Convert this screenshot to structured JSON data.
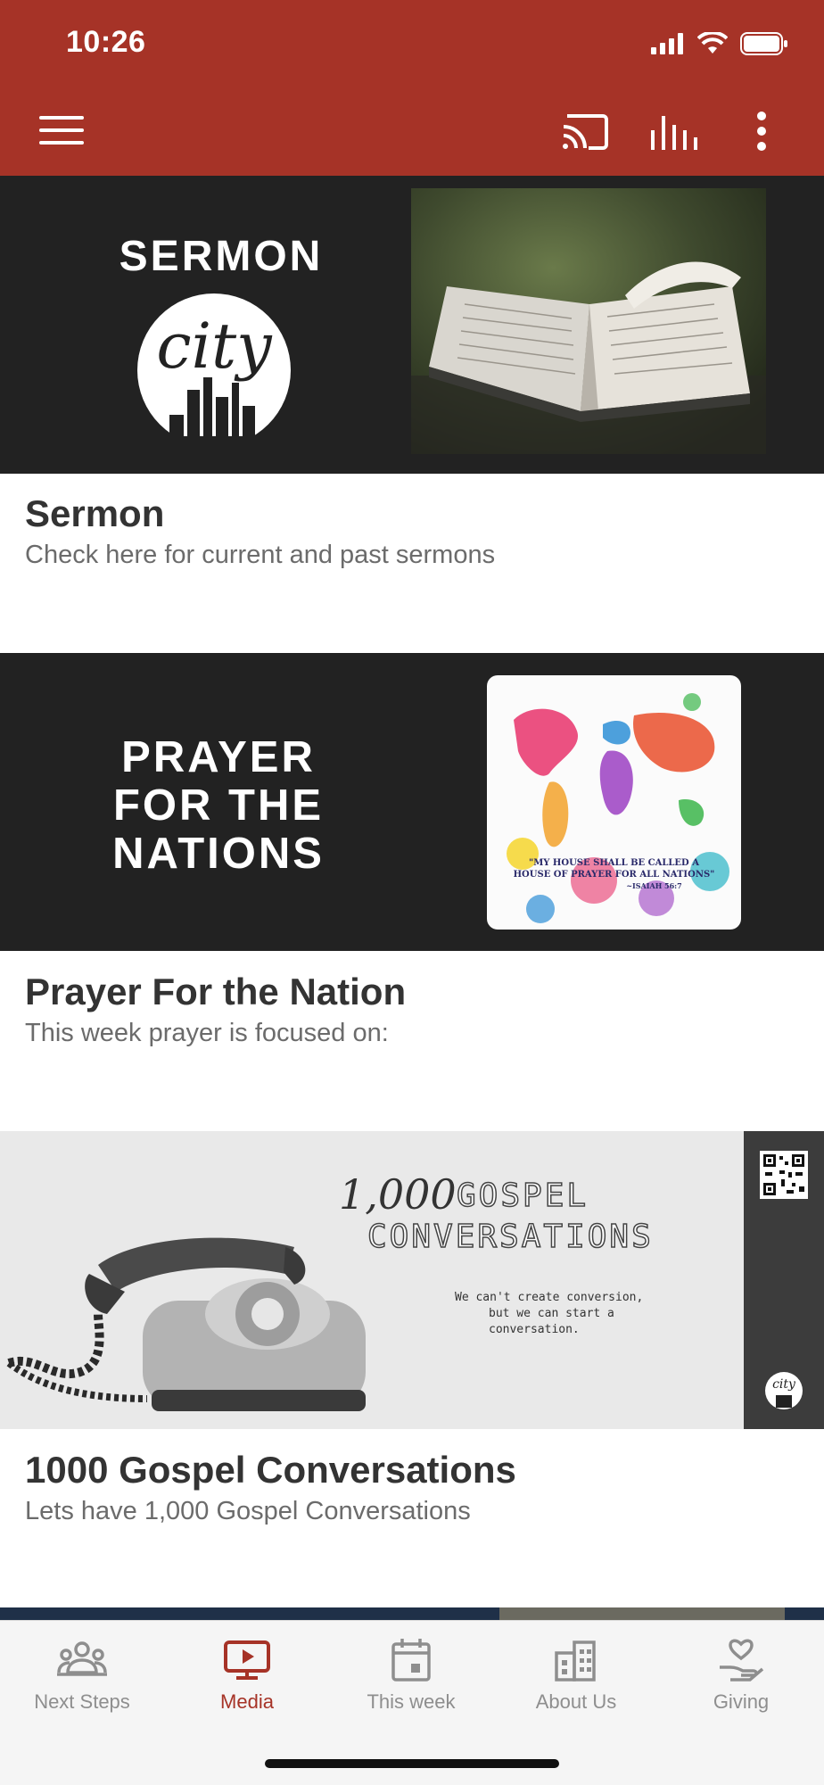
{
  "status_bar": {
    "time": "10:26"
  },
  "app_bar": {
    "menu_icon": "hamburger-icon",
    "actions": [
      "cast-icon",
      "equalizer-icon",
      "more-vertical-icon"
    ]
  },
  "cards": [
    {
      "banner_heading": "SERMON",
      "banner_logo_text": "city",
      "title": "Sermon",
      "description": "Check here for current and past sermons"
    },
    {
      "banner_heading_lines": [
        "PRAYER",
        "FOR THE",
        "NATIONS"
      ],
      "map_quote_line1": "\"MY HOUSE SHALL BE CALLED A",
      "map_quote_line2": "HOUSE OF PRAYER FOR ALL NATIONS\"",
      "map_quote_ref": "~ISAIAH 56:7",
      "title": "Prayer For the Nation",
      "description": "This week prayer is focused on:"
    },
    {
      "banner_count": "1,000",
      "banner_word1": "GOSPEL",
      "banner_word2": "CONVERSATIONS",
      "banner_tagline1": "We can't create conversion,",
      "banner_tagline2": "but we can start a conversation.",
      "banner_logo_text": "city",
      "title": "1000 Gospel Conversations",
      "description": "Lets have 1,000 Gospel Conversations"
    }
  ],
  "tabs": [
    {
      "label": "Next Steps",
      "icon": "people-group-icon",
      "active": false
    },
    {
      "label": "Media",
      "icon": "play-tv-icon",
      "active": true
    },
    {
      "label": "This week",
      "icon": "calendar-icon",
      "active": false
    },
    {
      "label": "About Us",
      "icon": "buildings-icon",
      "active": false
    },
    {
      "label": "Giving",
      "icon": "heart-hand-icon",
      "active": false
    }
  ],
  "colors": {
    "primary": "#a63327",
    "tab_active": "#a63327",
    "tab_inactive": "#8e8e8e"
  }
}
